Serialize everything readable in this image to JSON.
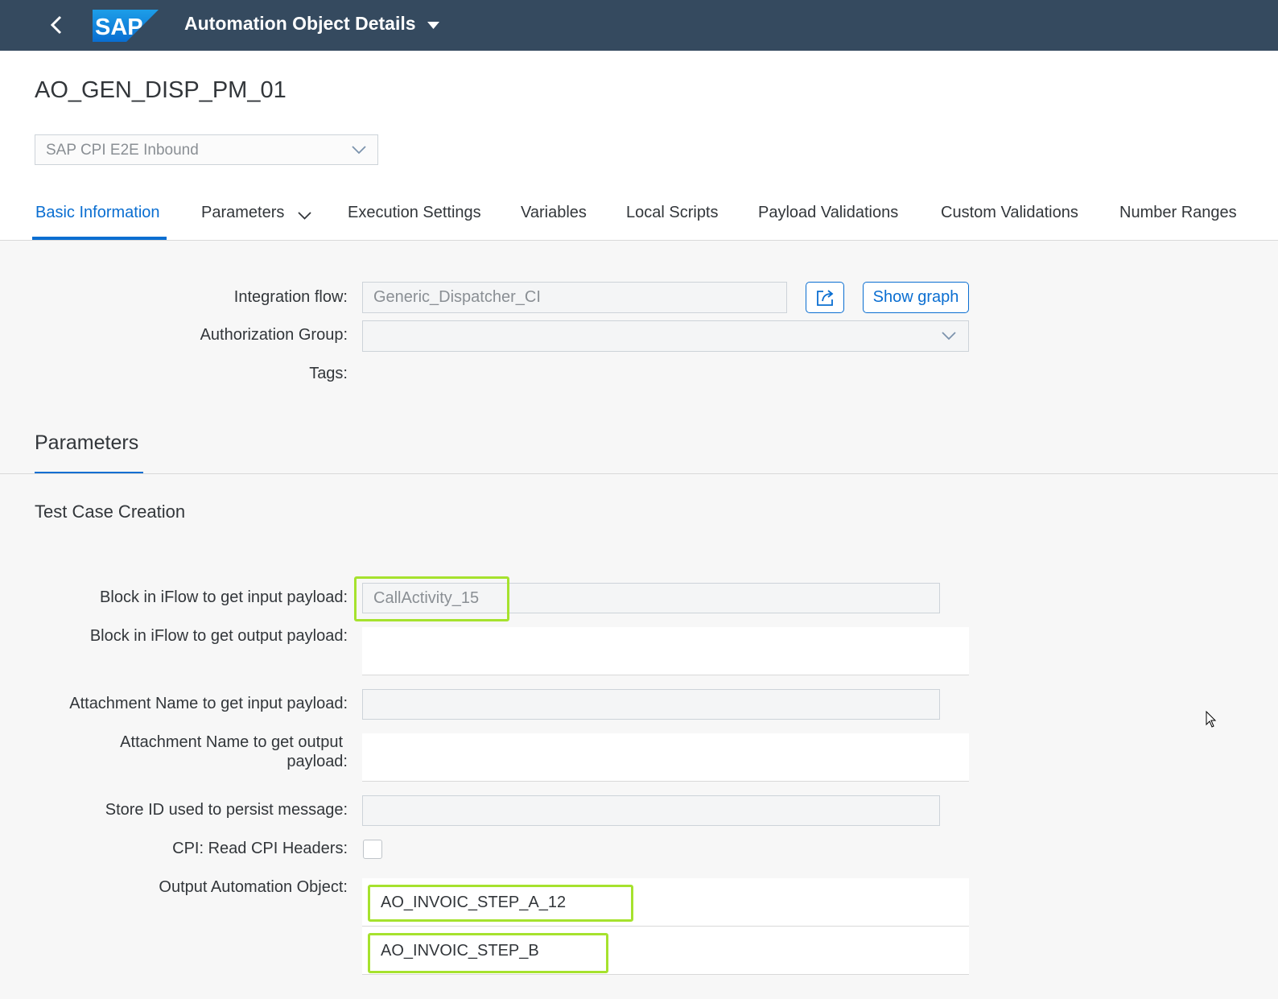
{
  "shell": {
    "app_title": "Automation Object Details",
    "logo_text": "SAP"
  },
  "header": {
    "object_title": "AO_GEN_DISP_PM_01",
    "variant_select": {
      "value": "SAP CPI E2E Inbound"
    }
  },
  "tabs": [
    {
      "label": "Basic Information",
      "active": true
    },
    {
      "label": "Parameters",
      "has_menu": true
    },
    {
      "label": "Execution Settings"
    },
    {
      "label": "Variables"
    },
    {
      "label": "Local Scripts"
    },
    {
      "label": "Payload Validations"
    },
    {
      "label": "Custom Validations"
    },
    {
      "label": "Number Ranges"
    }
  ],
  "basic": {
    "integration_flow_label": "Integration flow:",
    "integration_flow_value": "Generic_Dispatcher_CI",
    "show_graph_label": "Show graph",
    "authorization_group_label": "Authorization Group:",
    "authorization_group_value": "",
    "tags_label": "Tags:"
  },
  "parameters": {
    "section_title": "Parameters",
    "subsection_title": "Test Case Creation",
    "block_input_label": "Block in iFlow to get input payload:",
    "block_input_value": "CallActivity_15",
    "block_output_label": "Block in iFlow to get output payload:",
    "attach_input_label": "Attachment Name to get input payload:",
    "attach_output_label_line1": "Attachment Name to get output",
    "attach_output_label_line2": "payload:",
    "store_id_label": "Store ID used to persist message:",
    "cpi_headers_label": "CPI: Read CPI Headers:",
    "cpi_headers_checked": false,
    "output_ao_label": "Output Automation Object:",
    "output_ao_values": [
      "AO_INVOIC_STEP_A_12",
      "AO_INVOIC_STEP_B"
    ]
  },
  "colors": {
    "shell": "#354a5f",
    "accent": "#0a6ed1",
    "highlight": "#a6e22e"
  },
  "icons": {
    "back": "chevron-left-icon",
    "title_menu": "caret-down-icon",
    "select_arrow": "chevron-down-icon",
    "open_external": "open-external-icon"
  }
}
